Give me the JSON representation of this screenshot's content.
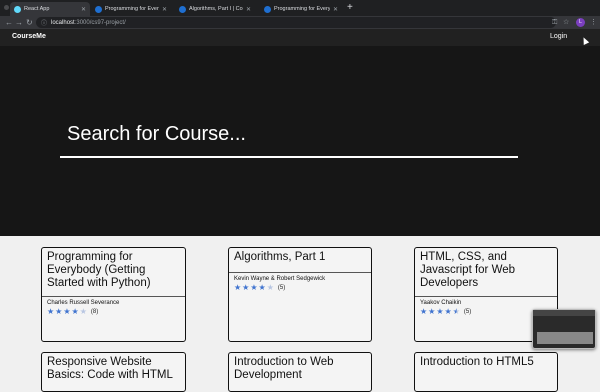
{
  "browser": {
    "tabs": [
      {
        "title": "React App",
        "favicon": "react-icon"
      },
      {
        "title": "Programming for Everybody (G",
        "favicon": "coursera-icon"
      },
      {
        "title": "Algorithms, Part I | Coursera",
        "favicon": "coursera-icon"
      },
      {
        "title": "Programming for Everybody (G",
        "favicon": "coursera-icon"
      }
    ],
    "new_tab": "+",
    "url_host": "localhost",
    "url_path": ":3000/cs97-project/",
    "avatar_letter": "L",
    "nav": {
      "back": "←",
      "forward": "→",
      "reload": "↻"
    }
  },
  "app": {
    "brand": "CourseMe",
    "login_label": "Login",
    "search_placeholder": "Search for Course..."
  },
  "courses": [
    {
      "title": "Programming for Everybody (Getting Started with Python)",
      "author": "Charles Russell Severance",
      "stars": 4,
      "count": "(8)"
    },
    {
      "title": "Algorithms, Part 1",
      "author": "Kevin Wayne & Robert Sedgewick",
      "stars": 4,
      "count": "(5)"
    },
    {
      "title": "HTML, CSS, and Javascript for Web Developers",
      "author": "Yaakov Chaikin",
      "stars": 4.5,
      "count": "(5)"
    },
    {
      "title": "Responsive Website Basics: Code with HTML",
      "author": "",
      "stars": 0,
      "count": ""
    },
    {
      "title": "Introduction to Web Development",
      "author": "",
      "stars": 0,
      "count": ""
    },
    {
      "title": "Introduction to HTML5",
      "author": "",
      "stars": 0,
      "count": ""
    }
  ],
  "colors": {
    "star": "#3f73cf",
    "hero_bg": "#161616",
    "navbar_bg": "#212121"
  }
}
